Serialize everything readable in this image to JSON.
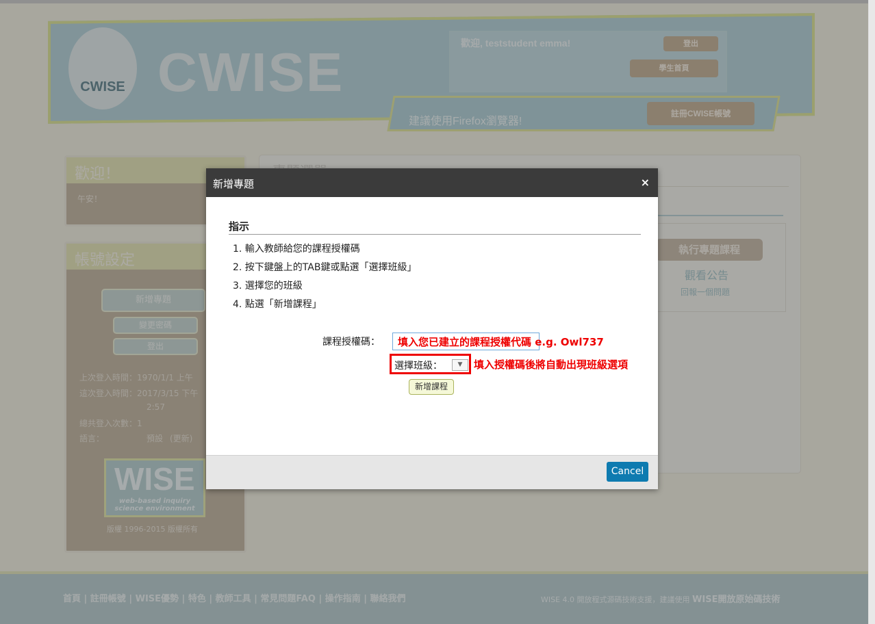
{
  "header": {
    "logo_text": "CWISE",
    "brand": "CWISE",
    "welcome": "歡迎, teststudent emma!",
    "logout": "登出",
    "student_home": "學生首頁",
    "browser_tip": "建議使用Firefox瀏覽器!",
    "register": "註冊CWISE帳號"
  },
  "left": {
    "welcome_title": "歡迎！",
    "greeting": "午安！",
    "account_title": "帳號設定",
    "add_project": "新增專題",
    "change_password": "變更密碼",
    "logout": "登出",
    "last_login": "上次登入時間：1970/1/1 上午",
    "this_login": "這次登入時間：2017/3/15 下午",
    "this_login_time": "2:57",
    "login_count": "總共登入次數：1",
    "language": "語言：",
    "language_value": "預設",
    "language_change": "(更新)",
    "wise_logo": "WISE",
    "wise_sub1": "web-based inquiry",
    "wise_sub2": "science environment",
    "copyright": "版權 1996-2015 版權所有"
  },
  "main": {
    "heading": "專題選單",
    "run_project": "執行專題課程",
    "announcements": "觀看公告",
    "report_problem": "回報一個問題"
  },
  "footer": {
    "links": "首頁 | 註冊帳號 | WISE優勢 | 特色 | 教師工具 | 常見問題FAQ | 操作指南 | 聯絡我們",
    "right_prefix": "WISE 4.0 開放程式源碼技術支援，建議使用",
    "right_bold": "WISE開放原始碼技術"
  },
  "modal": {
    "title": "新增專題",
    "close": "×",
    "instructions_title": "指示",
    "steps": [
      "1. 輸入教師給您的課程授權碼",
      "2. 按下鍵盤上的TAB鍵或點選「選擇班級」",
      "3. 選擇您的班級",
      "4. 點選「新增課程」"
    ],
    "code_label": "課程授權碼：",
    "code_annotation": "填入您已建立的課程授權代碼 e.g. Owl737",
    "class_label": "選擇班級：",
    "class_select": "▼",
    "class_annotation": "填入授權碼後將自動出現班級選項",
    "add_course": "新增課程",
    "cancel": "Cancel"
  }
}
